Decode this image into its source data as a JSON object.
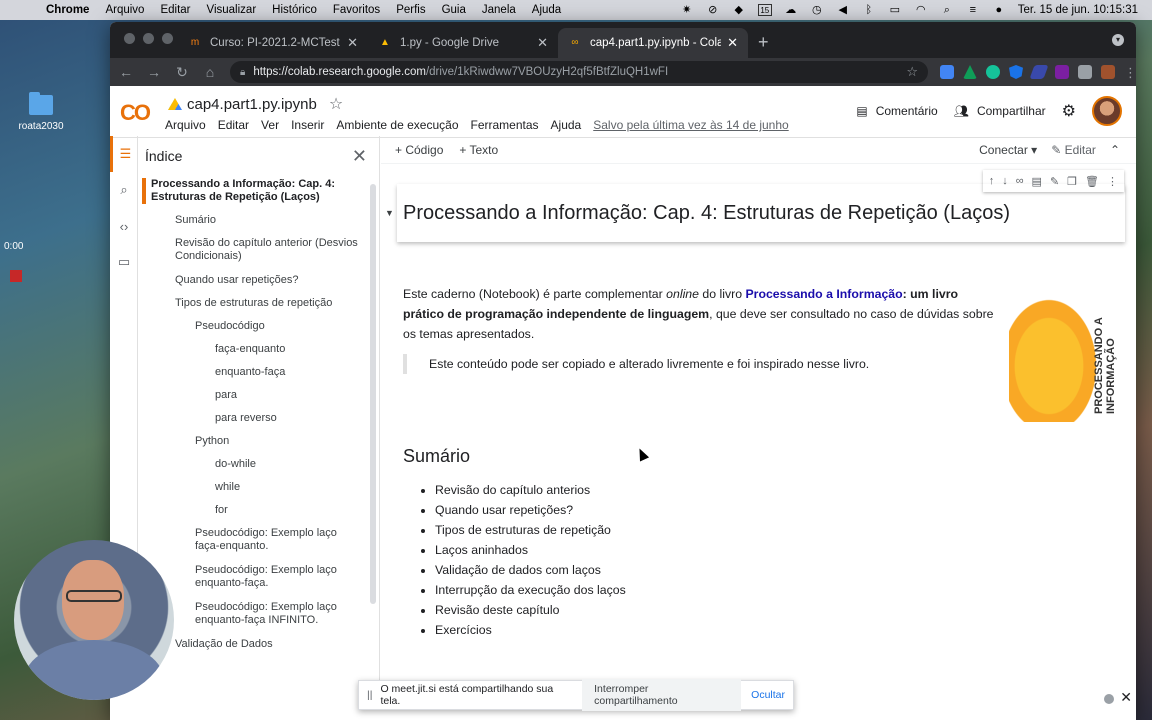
{
  "os_menu": {
    "app": "Chrome",
    "items": [
      "Arquivo",
      "Editar",
      "Visualizar",
      "Histórico",
      "Favoritos",
      "Perfis",
      "Guia",
      "Janela",
      "Ajuda"
    ],
    "clock": "Ter. 15 de jun.  10:15:31",
    "calendar_day": "15"
  },
  "desktop": {
    "folder_label": "roata2030",
    "timer": "0:00"
  },
  "tabs": [
    {
      "label": "Curso: PI-2021.2-MCTest",
      "icon": "moodle-icon"
    },
    {
      "label": "1.py - Google Drive",
      "icon": "drive-icon"
    },
    {
      "label": "cap4.part1.py.ipynb - Colabora",
      "icon": "colab-icon"
    }
  ],
  "url": {
    "host": "https://colab.research.google.com",
    "path": "/drive/1kRiwdww7VBOUzyH2qf5fBtfZluQH1wFI"
  },
  "colab": {
    "logo": "CO",
    "title": "cap4.part1.py.ipynb",
    "menu": [
      "Arquivo",
      "Editar",
      "Ver",
      "Inserir",
      "Ambiente de execução",
      "Ferramentas",
      "Ajuda"
    ],
    "saved": "Salvo pela última vez às 14 de junho",
    "comment": "Comentário",
    "share": "Compartilhar"
  },
  "toc": {
    "title": "Índice",
    "items": [
      "Processando a Informação: Cap. 4: Estruturas de Repetição (Laços)",
      "Sumário",
      "Revisão do capítulo anterior (Desvios Condicionais)",
      "Quando usar repetições?",
      "Tipos de estruturas de repetição",
      "Pseudocódigo",
      "faça-enquanto",
      "enquanto-faça",
      "para",
      "para reverso",
      "Python",
      "do-while",
      "while",
      "for",
      "Pseudocódigo: Exemplo laço faça-enquanto.",
      "Pseudocódigo: Exemplo laço enquanto-faça.",
      "Pseudocódigo: Exemplo laço enquanto-faça INFINITO.",
      "Validação de Dados"
    ]
  },
  "nb_toolbar": {
    "code": "Código",
    "text": "Texto",
    "connect": "Conectar",
    "edit": "Editar"
  },
  "cell": {
    "heading": "Processando a Informação: Cap. 4: Estruturas de Repetição (Laços)",
    "p1": "Este caderno (Notebook) é parte complementar ",
    "p_online": "online",
    "p2": " do livro ",
    "link": "Processando a Informação",
    "p_bold": ": um livro prático de programação independente de linguagem",
    "p3": ", que deve ser consultado no caso de dúvidas sobre os temas apresentados.",
    "quote": "Este conteúdo pode ser copiado e alterado livremente e foi inspirado nesse livro.",
    "book_title": "PROCESSANDO A INFORMAÇÃO"
  },
  "summary": {
    "heading": "Sumário",
    "items": [
      "Revisão do capítulo anterios",
      "Quando usar repetições?",
      "Tipos de estruturas de repetição",
      "Laços aninhados",
      "Validação de dados com laços",
      "Interrupção da execução dos laços",
      "Revisão deste capítulo",
      "Exercícios"
    ]
  },
  "share_bar": {
    "grip": "||",
    "text": "O meet.jit.si está compartilhando sua tela.",
    "stop": "Interromper compartilhamento",
    "hide": "Ocultar"
  }
}
